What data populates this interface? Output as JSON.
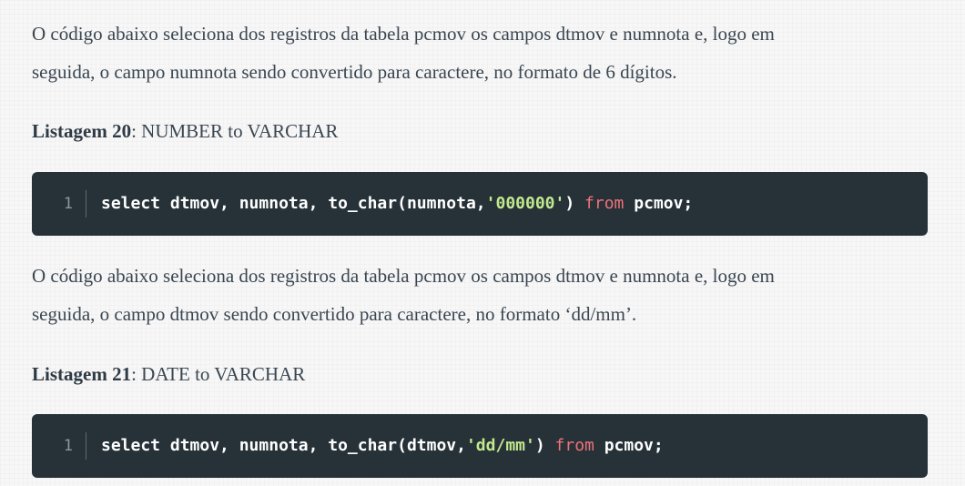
{
  "paragraphs": [
    {
      "line1": "O código abaixo seleciona dos registros da tabela pcmov os campos dtmov e numnota e, logo em",
      "line2": "seguida, o campo numnota sendo convertido para caractere, no formato de 6 dígitos."
    },
    {
      "line1": "O código abaixo seleciona dos registros da tabela pcmov os campos dtmov e numnota e, logo em",
      "line2": "seguida, o campo dtmov sendo convertido para caractere, no formato ‘dd/mm’."
    }
  ],
  "listings": [
    {
      "label": "Listagem 20",
      "title": ": NUMBER to VARCHAR",
      "line_number": "1",
      "code": {
        "before": "select dtmov, numnota, to_char(numnota,",
        "string": "'000000'",
        "paren": ") ",
        "keyword": "from",
        "after": " pcmov;"
      }
    },
    {
      "label": "Listagem 21",
      "title": ": DATE to VARCHAR",
      "line_number": "1",
      "code": {
        "before": "select dtmov, numnota, to_char(dtmov,",
        "string": "'dd/mm'",
        "paren": ") ",
        "keyword": "from",
        "after": " pcmov;"
      }
    }
  ],
  "colors": {
    "code_background": "#263238",
    "code_text": "#ffffff",
    "string_literal": "#c3e88d",
    "keyword": "#f07178",
    "body_text": "#3a4651"
  }
}
